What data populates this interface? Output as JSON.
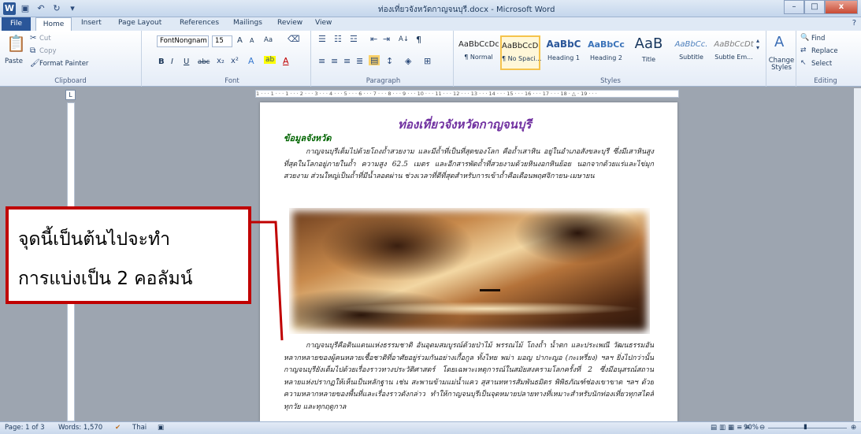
{
  "titlebar": {
    "title": "ท่องเที่ยวจังหวัดกาญจนบุรี.docx - Microsoft Word",
    "app_icon": "W",
    "minimize": "–",
    "maximize": "□",
    "close": "x"
  },
  "tabs": [
    "File",
    "Home",
    "Insert",
    "Page Layout",
    "References",
    "Mailings",
    "Review",
    "View"
  ],
  "help_icon": "?",
  "clipboard": {
    "label": "Clipboard",
    "paste": "Paste",
    "cut": "Cut",
    "copy": "Copy",
    "format_painter": "Format Painter"
  },
  "font": {
    "label": "Font",
    "family": "FontNongnam",
    "size": "15",
    "bold": "B",
    "italic": "I",
    "underline": "U",
    "strike": "abc",
    "grow": "A",
    "change_case": "Aa"
  },
  "paragraph": {
    "label": "Paragraph",
    "sort": "A↓",
    "pilcrow": "¶"
  },
  "styles": {
    "label": "Styles",
    "items": [
      {
        "preview": "AaBbCcDc",
        "name": "¶ Normal"
      },
      {
        "preview": "AaBbCcDc",
        "name": "¶ No Spaci..."
      },
      {
        "preview": "AaBbC",
        "name": "Heading 1"
      },
      {
        "preview": "AaBbCc",
        "name": "Heading 2"
      },
      {
        "preview": "AaB",
        "name": "Title"
      },
      {
        "preview": "AaBbCc.",
        "name": "Subtitle"
      },
      {
        "preview": "AaBbCcDt",
        "name": "Subtle Em..."
      }
    ],
    "change_styles": "Change Styles"
  },
  "editing": {
    "label": "Editing",
    "find": "Find",
    "replace": "Replace",
    "select": "Select"
  },
  "ruler_text": "1 · · · 1 · · · 1 · · · 2 · · · 3 · · · 4 · · · 5 · · · 6 · · · 7 · · · 8 · · · 9 · · · 10 · · · 11 · · · 12 · · · 13 · · · 14 · · · 15 · · · 16 · · · 17 · · · 18 · △ · 19 · · ·",
  "document": {
    "title": "ท่องเที่ยวจังหวัดกาญจนบุรี",
    "heading": "ข้อมูลจังหวัด",
    "paragraph1": "กาญจนบุรีเต็มไปด้วยโถงถ้ำสวยงาม และมีถ้ำที่เป็นที่สุดของโลก คือถ้ำเสาหิน อยู่ในอำเภอสังขละบุรี ซึ่งมีเสาหินสูงที่สุดในโลกอยู่ภายในถ้ำ ความสูง 62.5 เมตร และอีกสารพัดถ้ำที่สวยงามด้วยหินงอกหินย้อย นอกจากด้วยแร่และไข่มุกสวยงาม ส่วนใหญ่เป็นถ้ำที่มีน้ำลอดผ่าน ช่วงเวลาที่ดีที่สุดสำหรับการเข้าถ้ำคือเดือนพฤศจิกายน-เมษายน",
    "paragraph2": "กาญจนบุรีคือดินแดนแห่งธรรมชาติ อันอุดมสมบูรณ์ด้วยป่าไม้ พรรณไม้ โถงถ้ำ น้ำตก และประเพณี วัฒนธรรมอันหลากหลายของผู้คนหลายเชื้อชาติที่อาศัยอยู่ร่วมกันอย่างเกื้อกูล ทั้งไทย พม่า มอญ ปากะญอ (กะเหรี่ยง) ฯลฯ ยิ่งไปกว่านั้น กาญจนบุรียังเต็มไปด้วยเรื่องราวทางประวัติศาสตร์ โดยเฉพาะเหตุการณ์ในสมัยสงครามโลกครั้งที่ 2 ซึ่งมีอนุสรณ์สถานหลายแห่งปรากฏให้เห็นเป็นหลักฐาน เช่น สะพานข้ามแม่น้ำแคว สุสานทหารสัมพันธมิตร พิพิธภัณฑ์ช่องเขาขาด ฯลฯ ด้วยความหลากหลายของพื้นที่และเรื่องราวดังกล่าว ทำให้กาญจนบุรีเป็นจุดหมายปลายทางที่เหมาะสำหรับนักท่องเที่ยวทุกสไตล์ ทุกวัย และทุกฤดูกาล"
  },
  "callout": {
    "line1": "จุดนี้เป็นต้นไปจะทำ",
    "line2": "การแบ่งเป็น 2 คอลัมน์"
  },
  "status": {
    "page": "Page: 1 of 3",
    "words": "Words: 1,570",
    "language": "Thai",
    "zoom": "90%"
  }
}
